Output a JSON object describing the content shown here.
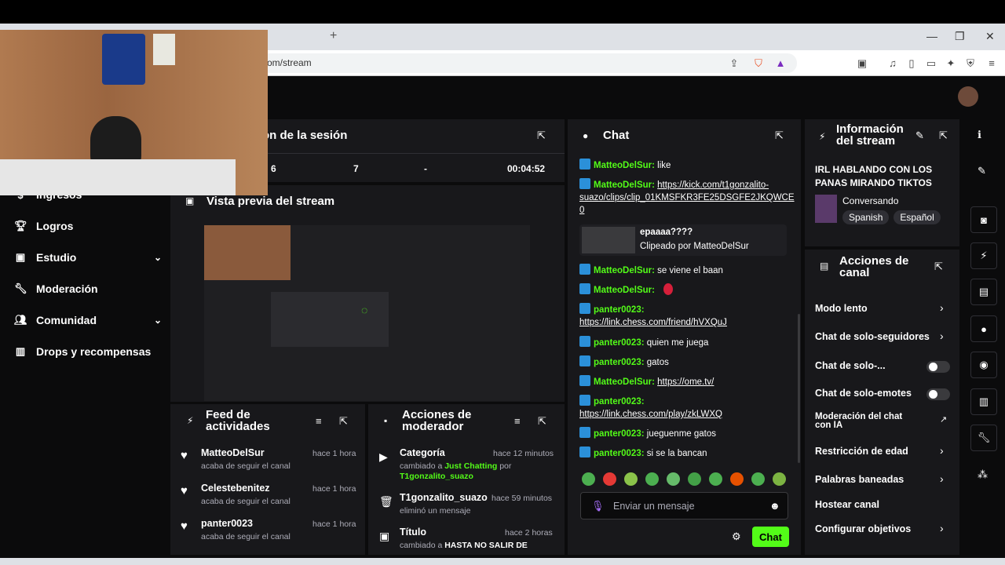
{
  "browser": {
    "url": "om/stream",
    "new_tab": "+",
    "min": "—",
    "max": "❐",
    "close": "✕"
  },
  "sidebar": {
    "items": [
      {
        "label": "Ingresos",
        "icon": "money-icon"
      },
      {
        "label": "Logros",
        "icon": "trophy-icon"
      },
      {
        "label": "Estudio",
        "icon": "studio-icon",
        "chevron": true
      },
      {
        "label": "Moderación",
        "icon": "wrench-icon"
      },
      {
        "label": "Comunidad",
        "icon": "community-icon",
        "chevron": true
      },
      {
        "label": "Drops y recompensas",
        "icon": "drops-icon"
      }
    ]
  },
  "session": {
    "title": "ón de la sesión",
    "stats": [
      "6",
      "7",
      "-",
      "00:04:52"
    ]
  },
  "preview": {
    "title": "Vista previa del stream"
  },
  "feed": {
    "title_1": "Feed de",
    "title_2": "actividades",
    "items": [
      {
        "user": "MatteoDelSur",
        "action": "acaba de seguir el canal",
        "time": "hace 1 hora"
      },
      {
        "user": "Celestebenitez",
        "action": "acaba de seguir el canal",
        "time": "hace 1 hora"
      },
      {
        "user": "panter0023",
        "action": "acaba de seguir el canal",
        "time": "hace 1 hora"
      }
    ]
  },
  "modactions": {
    "title_1": "Acciones de",
    "title_2": "moderador",
    "items": [
      {
        "title": "Categoría",
        "time": "hace 12 minutos",
        "line1_pre": "cambiado a ",
        "line1_hl": "Just Chatting",
        "line1_post": " por",
        "line2": "T1gonzalito_suazo"
      },
      {
        "title": "T1gonzalito_suazo",
        "time": "hace 59 minutos",
        "line1_pre": "eliminó un mensaje",
        "line1_hl": "",
        "line1_post": "",
        "line2": ""
      },
      {
        "title": "Título",
        "time": "hace 2 horas",
        "line1_pre": "cambiado a ",
        "line1_hl": "HASTA NO SALIR DE",
        "line1_post": "",
        "line2": ""
      }
    ]
  },
  "chat": {
    "title": "Chat",
    "placeholder": "Enviar un mensaje",
    "send": "Chat",
    "m1_user": "MatteoDelSur:",
    "m1_text": "like",
    "m2_user": "MatteoDelSur:",
    "m2_link_a": "https://kick.com/t1gonzalito-",
    "m2_link_b": "suazo/clips/clip_01KMSFKR3FE25DSGFE2JKQWCE",
    "m2_link_c": "0",
    "clip_title": "epaaaa????",
    "clip_by": "Clipeado por MatteoDelSur",
    "m3_user": "MatteoDelSur:",
    "m3_text": "se viene el baan",
    "m4_user": "MatteoDelSur:",
    "m5_user": "panter0023:",
    "m5_link": "https://link.chess.com/friend/hVXQuJ",
    "m6_user": "panter0023:",
    "m6_text": "quien me juega",
    "m7_user": "panter0023:",
    "m7_text": "gatos",
    "m8_user": "MatteoDelSur:",
    "m8_link": "https://ome.tv/",
    "m9_user": "panter0023:",
    "m9_link": "https://link.chess.com/play/zkLWXQ",
    "m10_user": "panter0023:",
    "m10_text": "jueguenme gatos",
    "m11_user": "panter0023:",
    "m11_text": "si se la bancan"
  },
  "info": {
    "title_1": "Información",
    "title_2": "del stream",
    "stream_title_1": "IRL HABLANDO CON LOS",
    "stream_title_2": "PANAS MIRANDO TIKTOS",
    "category": "Conversando",
    "tags": [
      "Spanish",
      "Español"
    ]
  },
  "channel": {
    "title_1": "Acciones de",
    "title_2": "canal",
    "items": [
      {
        "label": "Modo lento",
        "type": "arrow"
      },
      {
        "label": "Chat de solo-seguidores",
        "type": "arrow"
      },
      {
        "label": "Chat de solo-...",
        "type": "toggle"
      },
      {
        "label": "Chat de solo-emotes",
        "type": "toggle"
      },
      {
        "label": "Moderación del chat con IA",
        "type": "ext"
      },
      {
        "label": "Restricción de edad",
        "type": "arrow"
      },
      {
        "label": "Palabras baneadas",
        "type": "arrow"
      },
      {
        "label": "Hostear canal",
        "type": "none"
      },
      {
        "label": "Configurar objetivos",
        "type": "arrow"
      }
    ]
  },
  "colors": {
    "accent": "#53fc18",
    "panel": "#18181b",
    "bg": "#0b0b0c"
  }
}
